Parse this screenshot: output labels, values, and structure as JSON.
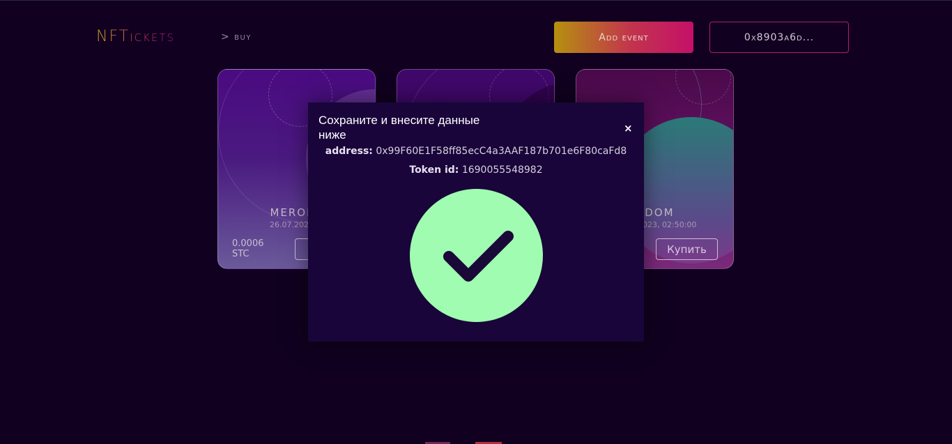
{
  "header": {
    "logo": "NFTickets",
    "breadcrumb": "> buy",
    "add_event_label": "Add event",
    "wallet_label": "0x8903a6d..."
  },
  "cards": [
    {
      "title": "MEROPR",
      "date": "26.07.2023, 0",
      "price": "0.0006",
      "currency": "STC"
    },
    {
      "title": "",
      "date": "",
      "price": "",
      "currency": ""
    },
    {
      "title": "NDOM",
      "date": "2023, 02:50:00",
      "buy_label": "Купить"
    }
  ],
  "modal": {
    "title": "Сохраните и внесите данные ниже",
    "close": "×",
    "address_label": "address:",
    "address_value": "0x99F60E1F58ff85ecC4a3AAF187b701e6F80caFd8",
    "token_label": "Token id:",
    "token_value": "1690055548982",
    "success_icon": "check-circle-icon"
  },
  "colors": {
    "background": "#110020",
    "modal_bg": "#19053a",
    "success": "#9ffcb0",
    "accent": "#c41068"
  }
}
